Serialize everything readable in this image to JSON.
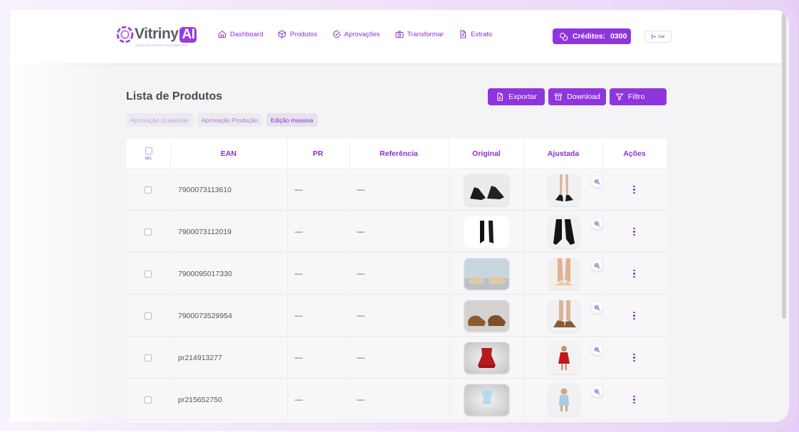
{
  "brand": {
    "name": "Vitriny",
    "ai": "AI",
    "tagline": "CATALOG PHOTO AUTOMATION",
    "accent": "#8f35dc"
  },
  "nav": {
    "items": [
      {
        "label": "Dashboard",
        "icon": "home-icon"
      },
      {
        "label": "Produtos",
        "icon": "box-icon"
      },
      {
        "label": "Aprovações",
        "icon": "check-circle-icon"
      },
      {
        "label": "Transformar",
        "icon": "camera-icon"
      },
      {
        "label": "Extrato",
        "icon": "document-icon"
      }
    ]
  },
  "credits": {
    "label": "Créditos:",
    "value": "0300",
    "icon": "coins-icon"
  },
  "logout": {
    "label": "Sair",
    "icon": "logout-icon"
  },
  "page": {
    "title": "Lista de Produtos",
    "actions": [
      {
        "label": "Exportar",
        "icon": "file-export-icon"
      },
      {
        "label": "Download",
        "icon": "archive-icon"
      },
      {
        "label": "Filtro",
        "icon": "filter-icon"
      }
    ],
    "chips": [
      "Aprovação Qualidade",
      "Aprovação Produção",
      "Edição massiva"
    ]
  },
  "table": {
    "sel_label": "SEL",
    "columns": [
      "EAN",
      "PR",
      "Referência",
      "Original",
      "Ajustada",
      "Ações"
    ],
    "rows": [
      {
        "ean": "7900073113610",
        "pr": "—",
        "ref": "—",
        "original": "black heeled sandals",
        "adjusted": "model legs wearing black heeled sandals"
      },
      {
        "ean": "7900073112019",
        "pr": "—",
        "ref": "—",
        "original": "black knee-high boots",
        "adjusted": "model legs wearing black knee-high boots"
      },
      {
        "ean": "7900095017330",
        "pr": "—",
        "ref": "—",
        "original": "beige flat sandals",
        "adjusted": "model feet wearing beige sandals"
      },
      {
        "ean": "7900073529954",
        "pr": "—",
        "ref": "—",
        "original": "brown oxford shoes",
        "adjusted": "model feet wearing brown shoes"
      },
      {
        "ean": "pr214913277",
        "pr": "—",
        "ref": "—",
        "original": "red child dress",
        "adjusted": "child model in red dress"
      },
      {
        "ean": "pr215652750",
        "pr": "—",
        "ref": "—",
        "original": "light blue baby romper",
        "adjusted": "baby model in light blue romper"
      }
    ]
  }
}
